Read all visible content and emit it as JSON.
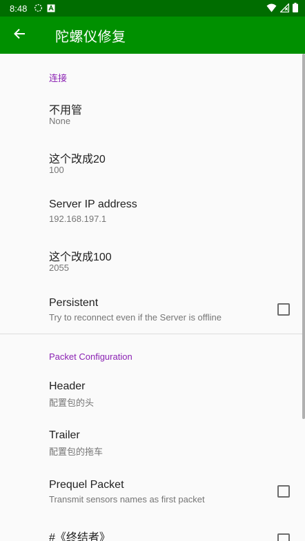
{
  "status_bar": {
    "time": "8:48",
    "icons": [
      "sync-icon",
      "a-box-icon",
      "wifi-icon",
      "no-signal-icon",
      "battery-icon"
    ]
  },
  "toolbar": {
    "title": "陀螺仪修复",
    "back_icon": "arrow-back-icon"
  },
  "colors": {
    "status_bar": "#006d00",
    "toolbar": "#009000",
    "section_header": "#8b22b3",
    "background": "#fafafa"
  },
  "sections": [
    {
      "header": "连接",
      "items": [
        {
          "title": "不用管",
          "summary": "None"
        },
        {
          "title": "这个改成20",
          "summary": "100"
        },
        {
          "title": "Server IP address",
          "summary": "192.168.197.1"
        },
        {
          "title": "这个改成100",
          "summary": "2055"
        },
        {
          "title": "Persistent",
          "summary": "Try to reconnect even if the Server is offline",
          "checked": false
        }
      ]
    },
    {
      "header": "Packet Configuration",
      "items": [
        {
          "title": "Header",
          "summary": "配置包的头"
        },
        {
          "title": "Trailer",
          "summary": "配置包的拖车"
        },
        {
          "title": "Prequel Packet",
          "summary": "Transmit sensors names as first packet",
          "checked": false
        },
        {
          "title": "#《终结者》",
          "checked": false
        }
      ]
    }
  ]
}
